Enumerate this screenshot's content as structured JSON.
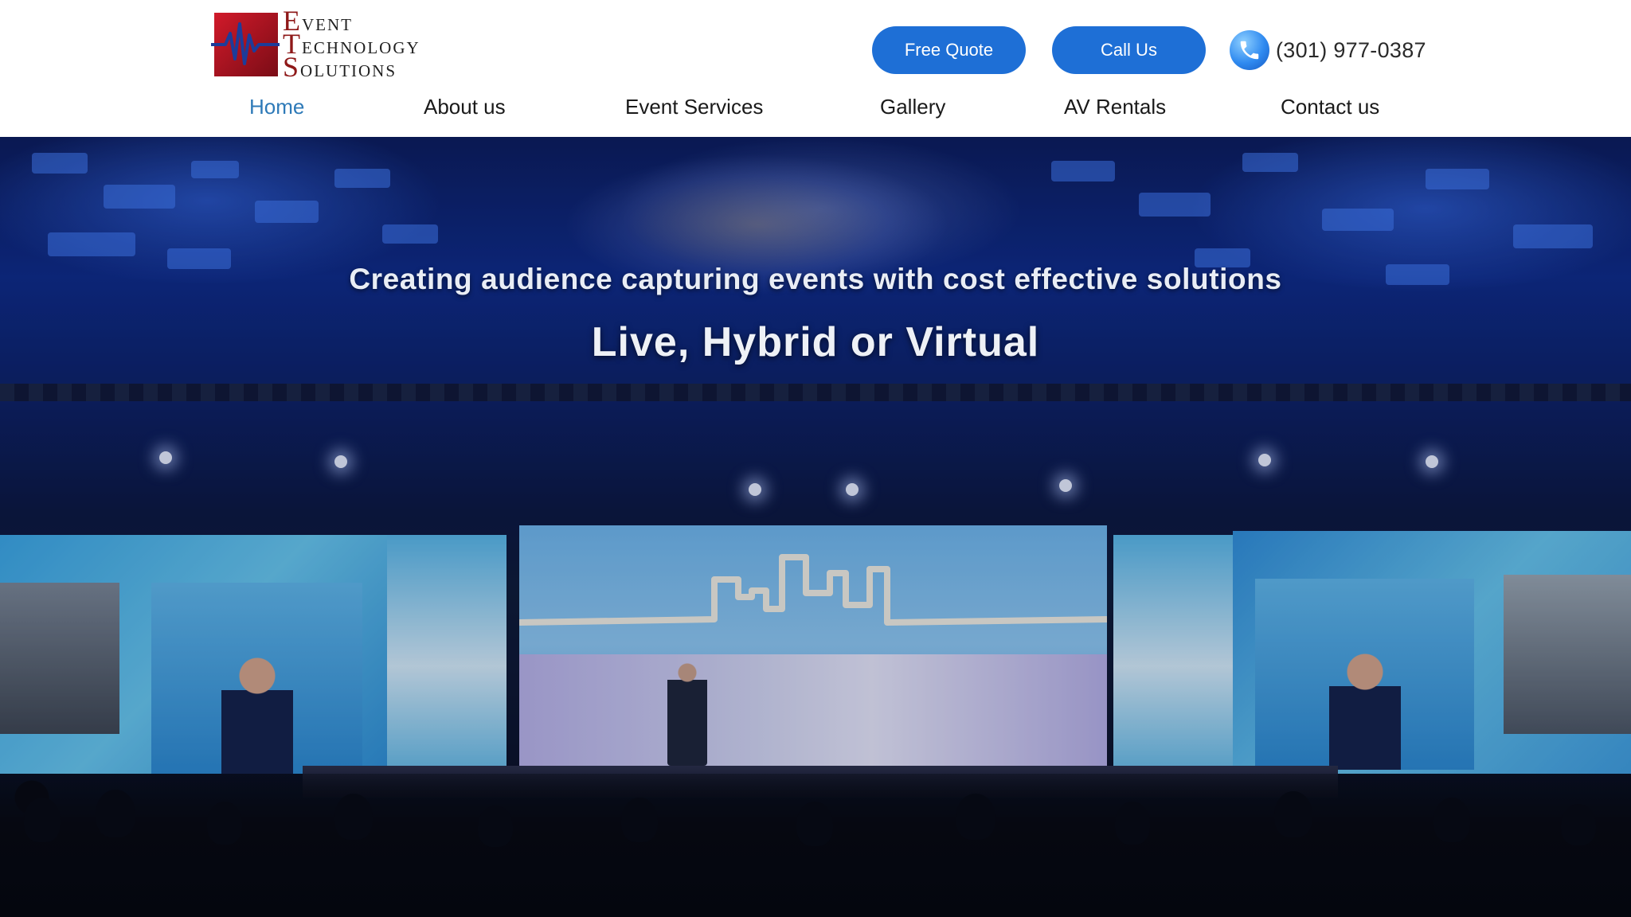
{
  "brand": {
    "logo_line1_cap": "E",
    "logo_line1_rest": "VENT",
    "logo_line2_cap": "T",
    "logo_line2_rest": "ECHNOLOGY",
    "logo_line3_cap": "S",
    "logo_line3_rest": "OLUTIONS",
    "accent_red": "#8e1818",
    "accent_blue": "#1e6fd6"
  },
  "header": {
    "quote_button": "Free Quote",
    "call_button": "Call Us",
    "phone_icon": "phone-icon",
    "phone_number": "(301) 977-0387"
  },
  "nav": {
    "items": [
      {
        "label": "Home",
        "active": true
      },
      {
        "label": "About us"
      },
      {
        "label": "Event Services"
      },
      {
        "label": "Gallery"
      },
      {
        "label": "AV Rentals"
      },
      {
        "label": "Contact us"
      }
    ],
    "active_color": "#2e7ab8"
  },
  "hero": {
    "subtitle": "Creating audience capturing events with cost effective solutions",
    "title": "Live, Hybrid or Virtual"
  }
}
